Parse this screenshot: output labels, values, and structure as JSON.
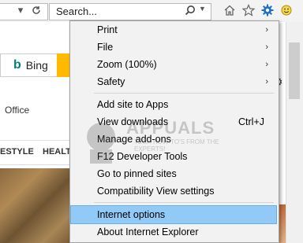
{
  "toolbar": {
    "search_value": "Search...",
    "icons": [
      "dropdown-arrow-icon",
      "refresh-icon",
      "search-icon",
      "home-icon",
      "favorites-star-icon",
      "tools-gear-icon"
    ]
  },
  "page": {
    "bing_label": "Bing",
    "bing_logo": "b",
    "office_link": "Office",
    "nav_items": [
      "ESTYLE",
      "HEALT"
    ]
  },
  "tools_menu": {
    "items": [
      {
        "label": "Print",
        "submenu": true
      },
      {
        "label": "File",
        "submenu": true
      },
      {
        "label": "Zoom (100%)",
        "submenu": true
      },
      {
        "label": "Safety",
        "submenu": true
      },
      {
        "label": "Add site to Apps"
      },
      {
        "label": "View downloads",
        "shortcut": "Ctrl+J"
      },
      {
        "label": "Manage add-ons"
      },
      {
        "label": "F12 Developer Tools"
      },
      {
        "label": "Go to pinned sites"
      },
      {
        "label": "Compatibility View settings"
      },
      {
        "label": "Internet options",
        "highlighted": true
      },
      {
        "label": "About Internet Explorer"
      }
    ],
    "arrow": "›"
  },
  "watermark": {
    "title": "APPUALS",
    "subtitle": "TECH HOW-TO'S FROM THE EXPERTS!"
  },
  "colors": {
    "highlight": "#91c9f7",
    "gear_blue": "#1f6fc5",
    "bing_teal": "#008373",
    "bing_yellow": "#ffb900"
  }
}
